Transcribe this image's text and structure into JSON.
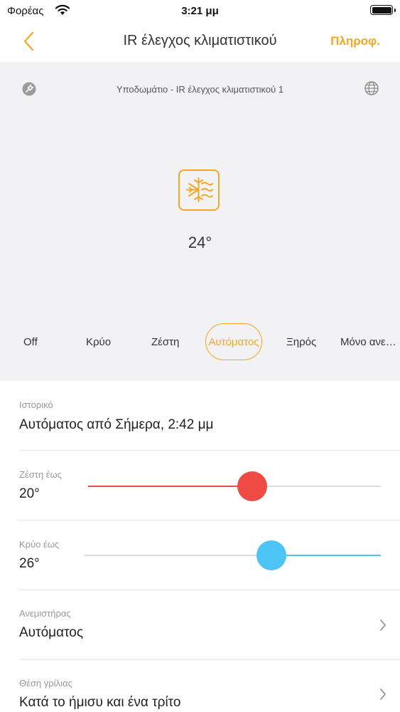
{
  "status_bar": {
    "carrier": "Φορέας",
    "time": "3:21 μμ"
  },
  "nav": {
    "title": "IR έλεγχος κλιματιστικού",
    "info_label": "Πληροφ."
  },
  "device": {
    "name": "Υποδωμάτιο - IR έλεγχος κλιματιστικού 1",
    "temperature": "24°",
    "mode_icon": "snowflake-heat-icon"
  },
  "modes": [
    "Off",
    "Κρύο",
    "Ζέστη",
    "Αυτόματος",
    "Ξηρός",
    "Μόνο ανε…"
  ],
  "active_mode_index": 3,
  "history": {
    "label": "Ιστορικό",
    "value": "Αυτόματος από Σήμερα, 2:42 μμ"
  },
  "heat_to": {
    "label": "Ζέστη έως",
    "value": "20°",
    "slider_fraction": 0.56
  },
  "cool_to": {
    "label": "Κρύο έως",
    "value": "26°",
    "slider_fraction": 0.63
  },
  "fan": {
    "label": "Ανεμιστήρας",
    "value": "Αυτόματος"
  },
  "louver": {
    "label": "Θέση γρίλιας",
    "value": "Κατά το ήμισυ και ένα τρίτο"
  },
  "colors": {
    "accent": "#F5A623",
    "heat": "#F04A45",
    "cool": "#4CC4F5"
  }
}
